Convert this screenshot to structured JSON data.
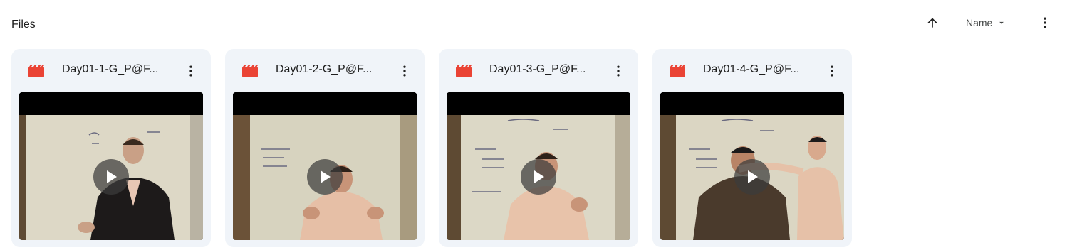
{
  "section": {
    "title": "Files"
  },
  "toolbar": {
    "sort_direction_icon": "arrow-up-icon",
    "sort_label": "Name",
    "sort_dropdown_icon": "caret-down-icon",
    "more_icon": "more-vert-icon"
  },
  "colors": {
    "video_icon": "#ea4335",
    "card_background": "#f0f4f9",
    "text": "#1f1f1f"
  },
  "files": [
    {
      "name": "Day01-1-G_P@F...",
      "type_icon": "video-file-icon",
      "menu_icon": "more-vert-icon",
      "play_icon": "play-icon"
    },
    {
      "name": "Day01-2-G_P@F...",
      "type_icon": "video-file-icon",
      "menu_icon": "more-vert-icon",
      "play_icon": "play-icon"
    },
    {
      "name": "Day01-3-G_P@F...",
      "type_icon": "video-file-icon",
      "menu_icon": "more-vert-icon",
      "play_icon": "play-icon"
    },
    {
      "name": "Day01-4-G_P@F...",
      "type_icon": "video-file-icon",
      "menu_icon": "more-vert-icon",
      "play_icon": "play-icon"
    }
  ]
}
